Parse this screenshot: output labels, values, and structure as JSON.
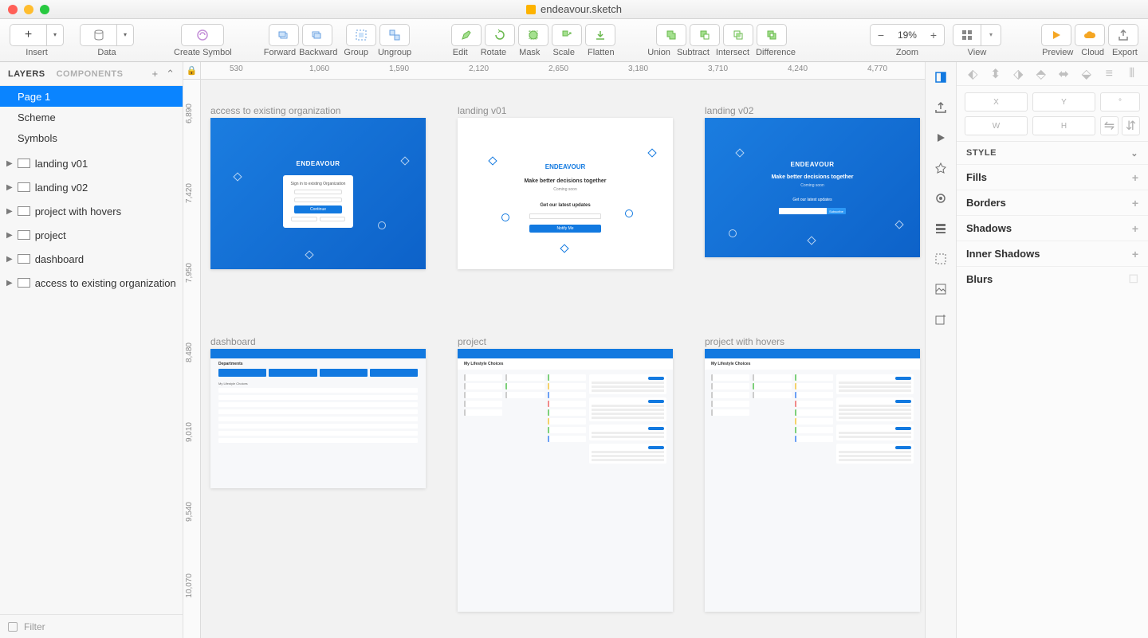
{
  "window": {
    "title": "endeavour.sketch"
  },
  "toolbar": {
    "insert": "Insert",
    "data": "Data",
    "create_symbol": "Create Symbol",
    "forward": "Forward",
    "backward": "Backward",
    "group": "Group",
    "ungroup": "Ungroup",
    "edit": "Edit",
    "rotate": "Rotate",
    "mask": "Mask",
    "scale": "Scale",
    "flatten": "Flatten",
    "union": "Union",
    "subtract": "Subtract",
    "intersect": "Intersect",
    "difference": "Difference",
    "zoom_label": "Zoom",
    "zoom_value": "19%",
    "view": "View",
    "preview": "Preview",
    "cloud": "Cloud",
    "export": "Export"
  },
  "left_panel": {
    "tabs": {
      "layers": "LAYERS",
      "components": "COMPONENTS"
    },
    "pages": [
      {
        "name": "Page 1",
        "selected": true
      },
      {
        "name": "Scheme",
        "selected": false
      },
      {
        "name": "Symbols",
        "selected": false
      }
    ],
    "layers": [
      {
        "name": "landing v01"
      },
      {
        "name": "landing v02"
      },
      {
        "name": "project with hovers"
      },
      {
        "name": "project"
      },
      {
        "name": "dashboard"
      },
      {
        "name": "access to existing organization"
      }
    ],
    "filter_placeholder": "Filter"
  },
  "ruler_h": [
    "530",
    "1,060",
    "1,590",
    "2,120",
    "2,650",
    "3,180",
    "3,710",
    "4,240",
    "4,770"
  ],
  "ruler_v": [
    "6,890",
    "7,420",
    "7,950",
    "8,480",
    "9,010",
    "9,540",
    "10,070"
  ],
  "artboards": {
    "row1": [
      {
        "label": "access to existing organization",
        "brand": "ENDEAVOUR",
        "heading": "Sign in to existing Organization",
        "button": "Continue"
      },
      {
        "label": "landing v01",
        "brand": "ENDEAVOUR",
        "heading": "Make better decisions together",
        "sub": "Coming soon",
        "cta": "Get our latest updates",
        "btn": "Notify Me"
      },
      {
        "label": "landing v02",
        "brand": "ENDEAVOUR",
        "heading": "Make better decisions together",
        "sub": "Coming soon",
        "cta": "Get our latest updates",
        "btn": "Subscribe"
      }
    ],
    "row2": [
      {
        "label": "dashboard",
        "title": "Departments",
        "section": "My Lifestyle Choices"
      },
      {
        "label": "project",
        "title": "My Lifestyle Choices"
      },
      {
        "label": "project with hovers",
        "title": "My Lifestyle Choices"
      }
    ]
  },
  "inspector": {
    "coords": {
      "x": "X",
      "y": "Y",
      "angle": "°",
      "w": "W",
      "h": "H"
    },
    "style_header": "STYLE",
    "fills": "Fills",
    "borders": "Borders",
    "shadows": "Shadows",
    "inner_shadows": "Inner Shadows",
    "blurs": "Blurs"
  }
}
